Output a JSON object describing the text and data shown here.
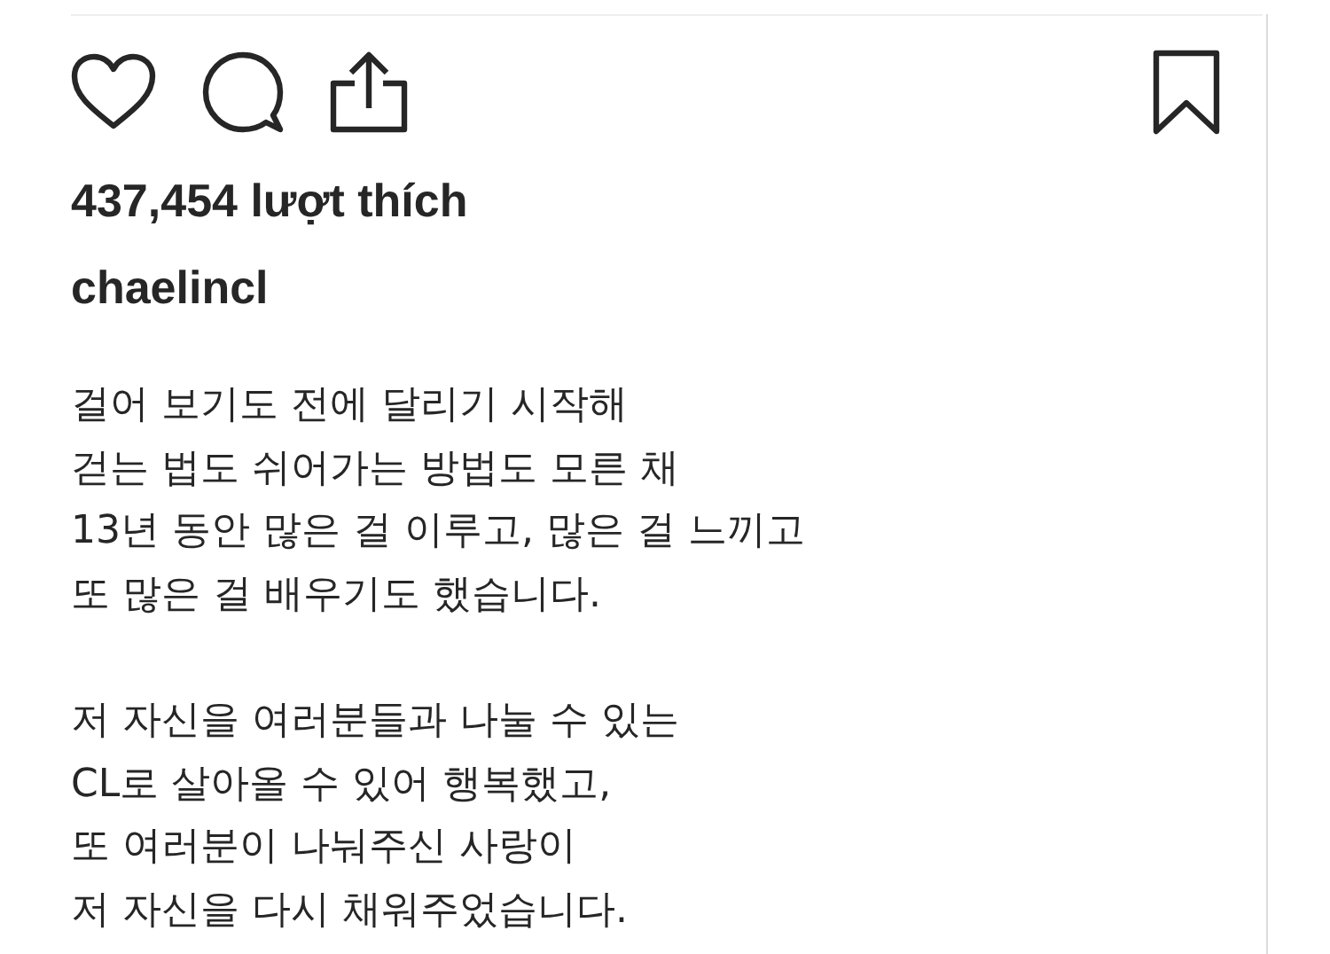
{
  "post": {
    "likes": "437,454 lượt thích",
    "username": "chaelincl",
    "caption": [
      "걸어 보기도 전에 달리기 시작해\n걷는 법도 쉬어가는 방법도 모른 채\n13년 동안 많은 걸 이루고, 많은 걸 느끼고\n또 많은 걸 배우기도 했습니다.",
      "저 자신을 여러분들과 나눌 수 있는\nCL로 살아올 수 있어 행복했고,\n또 여러분이 나눠주신 사랑이\n저 자신을 다시 채워주었습니다."
    ],
    "liked": false,
    "saved": false
  }
}
